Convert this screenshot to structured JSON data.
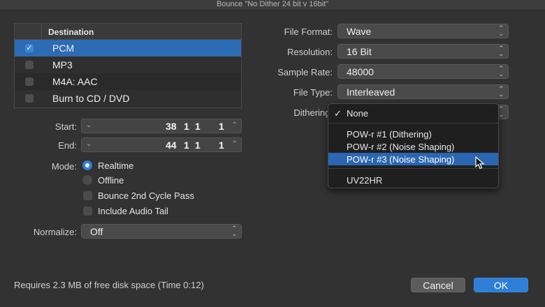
{
  "window": {
    "title": "Bounce \"No Dither 24 bit v 16bit\""
  },
  "destination": {
    "header": "Destination",
    "items": [
      {
        "label": "PCM",
        "checked": true
      },
      {
        "label": "MP3",
        "checked": false
      },
      {
        "label": "M4A: AAC",
        "checked": false
      },
      {
        "label": "Burn to CD / DVD",
        "checked": false
      }
    ]
  },
  "position": {
    "start_label": "Start:",
    "start": {
      "bar": "38",
      "beat": "1",
      "div": "1",
      "tick": "1"
    },
    "end_label": "End:",
    "end": {
      "bar": "44",
      "beat": "1",
      "div": "1",
      "tick": "1"
    }
  },
  "mode": {
    "label": "Mode:",
    "realtime": "Realtime",
    "offline": "Offline",
    "selected": "Realtime",
    "bounce_cycle": "Bounce 2nd Cycle Pass",
    "include_tail": "Include Audio Tail"
  },
  "normalize": {
    "label": "Normalize:",
    "value": "Off"
  },
  "format": {
    "file_format_label": "File Format:",
    "file_format": "Wave",
    "resolution_label": "Resolution:",
    "resolution": "16 Bit",
    "sample_rate_label": "Sample Rate:",
    "sample_rate": "48000",
    "file_type_label": "File Type:",
    "file_type": "Interleaved",
    "dithering_label": "Dithering:"
  },
  "dither_menu": {
    "items": [
      {
        "label": "None",
        "checked": true
      },
      {
        "label": "POW-r #1 (Dithering)"
      },
      {
        "label": "POW-r #2 (Noise Shaping)"
      },
      {
        "label": "POW-r #3 (Noise Shaping)",
        "highlighted": true
      },
      {
        "label": "UV22HR"
      }
    ]
  },
  "status": "Requires 2.3 MB of free disk space  (Time 0:12)",
  "buttons": {
    "cancel": "Cancel",
    "ok": "OK"
  },
  "colors": {
    "accent": "#2f7ed8",
    "selection": "#2d6cb5",
    "background": "#323232"
  }
}
